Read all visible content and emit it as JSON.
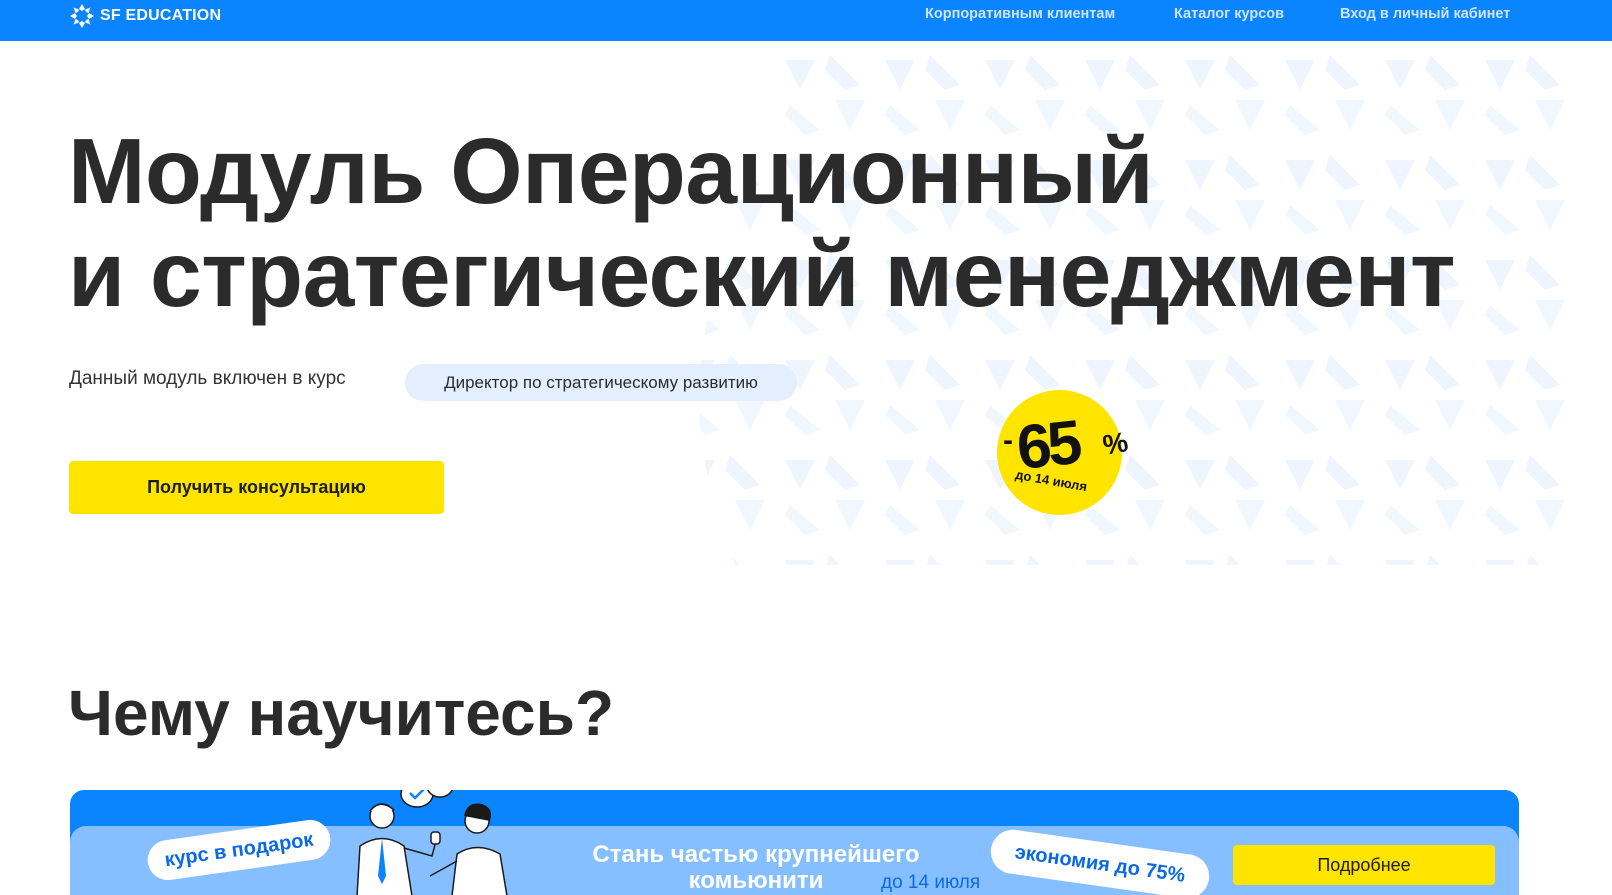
{
  "header": {
    "brand": "SF EDUCATION",
    "nav": [
      {
        "label": "Корпоративным клиентам"
      },
      {
        "label": "Каталог курсов"
      },
      {
        "label": "Вход в личный кабинет"
      }
    ]
  },
  "hero": {
    "title_line1": "Модуль Операционный",
    "title_line2": "и стратегический менеджмент",
    "included_text": "Данный модуль включен в курс",
    "course_chip": "Директор по стратегическому развитию",
    "cta_label": "Получить консультацию"
  },
  "discount_badge": {
    "minus": "-",
    "value": "65",
    "percent": "%",
    "until": "до 14 июля"
  },
  "section": {
    "title": "Чему научитесь?"
  },
  "promo_banner": {
    "gift_label": "курс в подарок",
    "headline": "Стань частью крупнейшего комьюнити",
    "date": "до 14 июля",
    "savings_label": "экономия до 75%",
    "more_label": "Подробнее"
  },
  "colors": {
    "header_blue": "#0a84ff",
    "accent_yellow": "#ffe400",
    "chip_bg": "#e3efff",
    "banner_light": "#86bfff",
    "text_dark": "#2b2b2b"
  }
}
